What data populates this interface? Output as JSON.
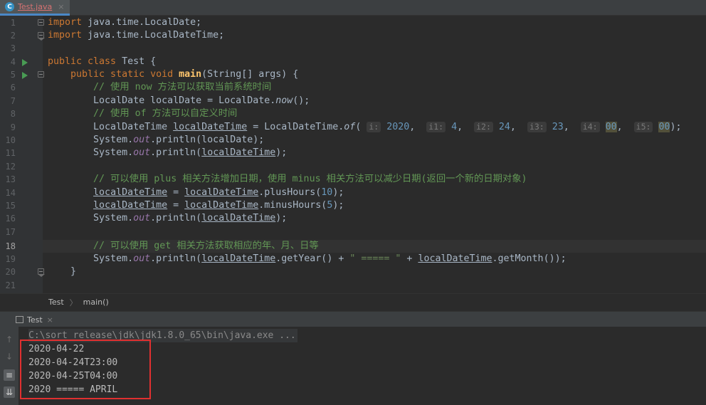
{
  "tabbar": {
    "file_tab": "Test.java",
    "file_icon": "C",
    "close": "×"
  },
  "editor": {
    "line_numbers": [
      "1",
      "2",
      "3",
      "4",
      "5",
      "6",
      "7",
      "8",
      "9",
      "10",
      "11",
      "12",
      "13",
      "14",
      "15",
      "16",
      "17",
      "18",
      "19",
      "20",
      "21"
    ],
    "current_line": "18"
  },
  "code": {
    "l1_kw": "import",
    "l1_rest": " java.time.LocalDate;",
    "l2_kw": "import",
    "l2_rest": " java.time.LocalDateTime;",
    "l4_kw": "public class",
    "l4_rest": " Test {",
    "l5_kw1": "    public static void ",
    "l5_fn": "main",
    "l5_rest": "(String[] args) {",
    "l6_cm": "        // 使用 now 方法可以获取当前系统时间",
    "l7_a": "        LocalDate localDate = LocalDate.",
    "l7_b": "now",
    "l7_c": "();",
    "l8_cm": "        // 使用 of 方法可以自定义时间",
    "l9_a": "        LocalDateTime ",
    "l9_var": "localDateTime",
    "l9_b": " = LocalDateTime.",
    "l9_of": "of",
    "l9_c": "( ",
    "l9_h1": "i:",
    "l9_n1": "2020",
    "l9_h2": "i1:",
    "l9_n2": "4",
    "l9_h3": "i2:",
    "l9_n3": "24",
    "l9_h4": "i3:",
    "l9_n4": "23",
    "l9_h5": "i4:",
    "l9_n5": "00",
    "l9_h6": "i5:",
    "l9_n6": "00",
    "l9_end": ");",
    "l10_a": "        System.",
    "l10_out": "out",
    "l10_b": ".println(localDate);",
    "l11_a": "        System.",
    "l11_out": "out",
    "l11_b": ".println(",
    "l11_var": "localDateTime",
    "l11_c": ");",
    "l13_cm": "        // 可以使用 plus 相关方法增加日期，使用 minus 相关方法可以减少日期(返回一个新的日期对象)",
    "l14_a": "        ",
    "l14_var": "localDateTime",
    "l14_b": " = ",
    "l14_var2": "localDateTime",
    "l14_c": ".plusHours(",
    "l14_n": "10",
    "l14_d": ");",
    "l15_a": "        ",
    "l15_var": "localDateTime",
    "l15_b": " = ",
    "l15_var2": "localDateTime",
    "l15_c": ".minusHours(",
    "l15_n": "5",
    "l15_d": ");",
    "l16_a": "        System.",
    "l16_out": "out",
    "l16_b": ".println(",
    "l16_var": "localDateTime",
    "l16_c": ");",
    "l18_cm": "        // 可以使用 get 相关方法获取相应的年、月、日等",
    "l19_a": "        System.",
    "l19_out": "out",
    "l19_b": ".println(",
    "l19_var": "localDateTime",
    "l19_c": ".getYear() + ",
    "l19_str": "\" ===== \"",
    "l19_d": " + ",
    "l19_var2": "localDateTime",
    "l19_e": ".getMonth());",
    "l20": "    }"
  },
  "breadcrumb": {
    "class": "Test",
    "sep": "〉",
    "method": "main()"
  },
  "run": {
    "tab_label": "Test",
    "close": "×"
  },
  "console": {
    "command": "C:\\sort release\\jdk\\jdk1.8.0_65\\bin\\java.exe ...",
    "output": [
      "2020-04-22",
      "2020-04-24T23:00",
      "2020-04-25T04:00",
      "2020 ===== APRIL"
    ]
  }
}
